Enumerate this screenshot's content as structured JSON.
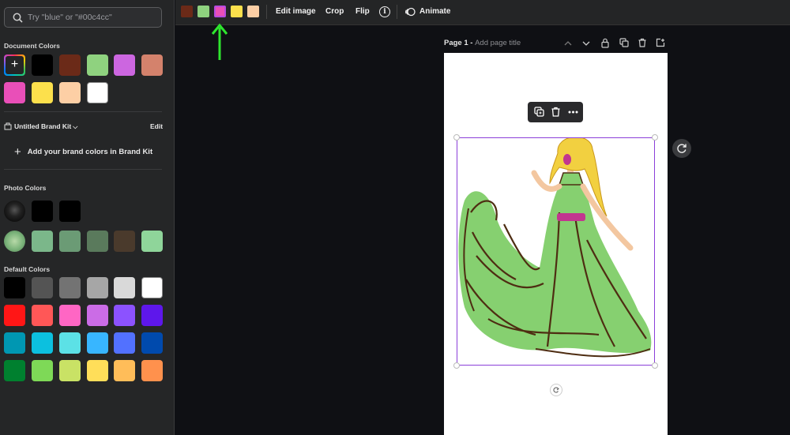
{
  "sidebar": {
    "search": {
      "placeholder": "Try \"blue\" or \"#00c4cc\"",
      "icon": "search-icon"
    },
    "document_colors": {
      "title": "Document Colors",
      "add_icon": "plus-icon",
      "swatches": [
        "#000000",
        "#6b2a18",
        "#8fd27f",
        "#cc66e0",
        "#d4826c",
        "#e94fb8",
        "#fce04c",
        "#fdcfa5",
        "#ffffff"
      ]
    },
    "brand_kit": {
      "title": "Untitled Brand Kit",
      "edit": "Edit",
      "add": "Add your brand colors in Brand Kit"
    },
    "photo_colors": {
      "title": "Photo Colors",
      "row1": [
        "#000000",
        "#000000"
      ],
      "row2": [
        "#7bb78a",
        "#6b9b75",
        "#5a7a5c",
        "#4a3a2c",
        "#8fd59a"
      ]
    },
    "default_colors": {
      "title": "Default Colors",
      "rows": [
        [
          "#000000",
          "#545454",
          "#737373",
          "#a6a6a6",
          "#d9d9d9",
          "#ffffff"
        ],
        [
          "#ff1616",
          "#ff5757",
          "#ff66c4",
          "#cb6ce6",
          "#8c52ff",
          "#5e17eb"
        ],
        [
          "#0097b2",
          "#0cc0df",
          "#5ce1e6",
          "#38b6ff",
          "#5271ff",
          "#004aad"
        ],
        [
          "#00802f",
          "#7ed957",
          "#c9e265",
          "#ffde59",
          "#ffbd59",
          "#ff914d"
        ]
      ]
    }
  },
  "toolbar": {
    "swatches": [
      "#6b2a18",
      "#8fd27f",
      "#e94fb8",
      "#fce04c",
      "#fdcfa5"
    ],
    "edit_image": "Edit image",
    "crop": "Crop",
    "flip": "Flip",
    "animate": "Animate"
  },
  "page": {
    "title": "Page 1 - ",
    "placeholder": "Add page title"
  },
  "colors": {
    "accent": "#8b3fd9",
    "arrow": "#2ee52e"
  }
}
